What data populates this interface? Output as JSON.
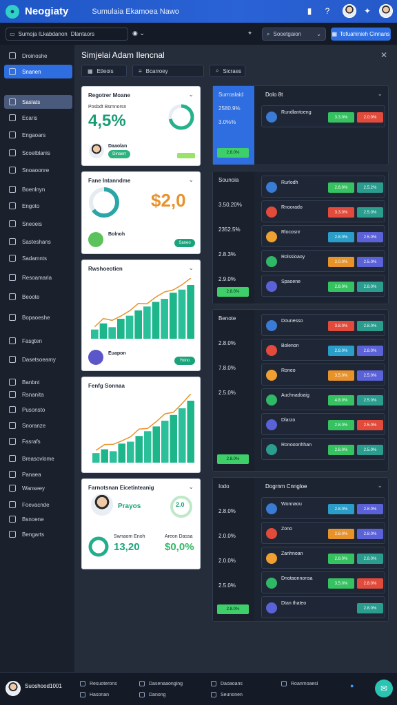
{
  "header": {
    "brand": "Neogiaty",
    "title": "Sumulaia Ekamoea Nawo"
  },
  "subbar": {
    "breadcrumb": [
      "Sumoja ILkabdanon",
      "Dlantaors"
    ],
    "search_label": "Sooetgaion",
    "action_label": "Tofuahinieh Cinnans"
  },
  "sidebar": {
    "items": [
      {
        "label": "Droinoshe"
      },
      {
        "label": "Snanen"
      },
      {
        "label": "Saslats"
      },
      {
        "label": "Ecaris"
      },
      {
        "label": "Engaoars"
      },
      {
        "label": "Scoelblanis"
      },
      {
        "label": "Snoaoonre"
      },
      {
        "label": "Boenlnyn"
      },
      {
        "label": "Engoto"
      },
      {
        "label": "Sneoeis"
      },
      {
        "label": "Sasteshans"
      },
      {
        "label": "Sadamnts"
      },
      {
        "label": "Resoamaria"
      },
      {
        "label": "Beoote"
      },
      {
        "label": "Bopaoeshe"
      },
      {
        "label": "Fasgten"
      },
      {
        "label": "Dasetsoeamy"
      },
      {
        "label": "Banbnt"
      },
      {
        "label": "Rsnanita"
      },
      {
        "label": "Pusonsto"
      },
      {
        "label": "Snoranze"
      },
      {
        "label": "Fasrafs"
      },
      {
        "label": "Breasovlome"
      },
      {
        "label": "Panaea"
      },
      {
        "label": "Wanseey"
      },
      {
        "label": "Foevacnde"
      },
      {
        "label": "Bsnoene"
      },
      {
        "label": "Bengarts"
      }
    ]
  },
  "main": {
    "title": "Simjelai Adam Ilencnal",
    "tabs": [
      {
        "label": "Etleois"
      },
      {
        "label": "Bcarroey"
      },
      {
        "label": "Sicraes"
      }
    ]
  },
  "cards": [
    {
      "title": "Regotrer Moane",
      "subtitle": "Posbdt Bsmnorsn",
      "big": "4,5%",
      "name": "Daaolan",
      "pill": "Dinaerr",
      "progress": 0.72
    },
    {
      "title": "Fane Intanndme",
      "big": "$2,0",
      "name": "Bolnoh",
      "pill": "Saneo",
      "progress": 0.65
    },
    {
      "title": "Rwshoeotien",
      "name": "Euapon",
      "pill": "Yoino",
      "bars": [
        12,
        20,
        15,
        26,
        30,
        37,
        42,
        48,
        52,
        60,
        64,
        70
      ]
    },
    {
      "title": "Fenfg Sonnaa",
      "bars": [
        10,
        14,
        12,
        20,
        22,
        28,
        33,
        38,
        44,
        50,
        57,
        65
      ]
    },
    {
      "title": "Farnotsnan Eicetinteanig",
      "ring": "2.0",
      "name": "Prayos",
      "big": "13,20",
      "big2": "$0,0%",
      "sub1": "Swnaom Enoh",
      "sub2": "Areon Dassa"
    }
  ],
  "panels": [
    {
      "left": [
        "Surroslaid",
        "2580.9%",
        "3.0%%"
      ],
      "btn": "2.8.0%",
      "header": "Dolo 8t",
      "rows": [
        {
          "name": "Rundlantoeng",
          "a": "3.3.0%",
          "b": "2.0.0%"
        }
      ]
    },
    {
      "left": [
        "Sounoia",
        "3.50.20%",
        "2352.5%",
        "2.8.3%",
        "2.9.0%"
      ],
      "btn": "2.8.0%",
      "rows": [
        {
          "name": "Rurlodh",
          "a": "2.8.0%",
          "b": "2.5.2%"
        },
        {
          "name": "Rnoorado",
          "a": "3.3.0%",
          "b": "2.5.0%"
        },
        {
          "name": "Rlocosnr",
          "a": "2.8.0%",
          "b": "2.5.0%"
        },
        {
          "name": "Rolssioaoy",
          "a": "2.0.0%",
          "b": "2.5.0%"
        },
        {
          "name": "Spaoene",
          "a": "2.8.0%",
          "b": "2.8.0%"
        }
      ]
    },
    {
      "left": [
        "Benote",
        "2.8.0%",
        "7.8.0%",
        "2.5.0%"
      ],
      "btn": "2.8.0%",
      "rows": [
        {
          "name": "Dounesso",
          "a": "3.8.0%",
          "b": "2.8.0%"
        },
        {
          "name": "Bolenon",
          "a": "2.8.0%",
          "b": "2.8.0%"
        },
        {
          "name": "Roneo",
          "a": "3.5.0%",
          "b": "2.5.0%"
        },
        {
          "name": "Auchnadoaig",
          "a": "4.8.0%",
          "b": "2.5.0%"
        },
        {
          "name": "Dlarzo",
          "a": "2.8.0%",
          "b": "2.5.0%"
        },
        {
          "name": "Ronooonhhan",
          "a": "2.8.0%",
          "b": "2.5.0%"
        }
      ]
    },
    {
      "left": [
        "Iodo",
        "2.8.0%",
        "2.0.0%",
        "2.0.0%",
        "2.5.0%"
      ],
      "btn": "2.8.0%",
      "header": "Dogrnm Cnngloe",
      "rows": [
        {
          "name": "Wonnaou",
          "a": "2.8.0%",
          "b": "2.8.0%"
        },
        {
          "name": "Zono",
          "a": "2.8.0%",
          "b": "2.8.0%"
        },
        {
          "name": "Zanhnoan",
          "a": "2.8.0%",
          "b": "2.8.0%"
        },
        {
          "name": "Dnotaonnonsa",
          "a": "3.5.0%",
          "b": "2.8.0%"
        },
        {
          "name": "Dtan thateo",
          "a": "",
          "b": "2.8.0%"
        }
      ]
    }
  ],
  "footer": {
    "user": "Suoshood1001",
    "links": [
      "Resuoterons",
      "Hasonan",
      "Dasenaaonging",
      "Danong",
      "Daoaoans",
      "Seunonen",
      "Roanmoaesi"
    ]
  }
}
